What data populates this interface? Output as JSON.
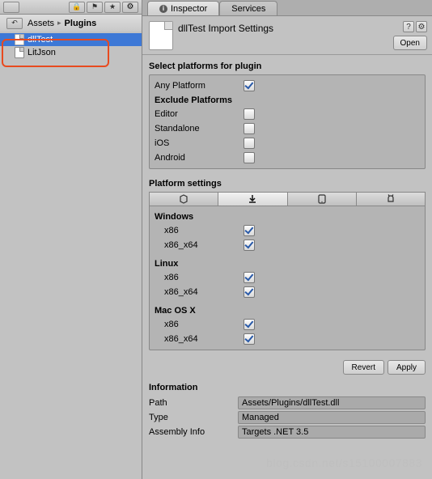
{
  "left": {
    "breadcrumb": {
      "root": "Assets",
      "current": "Plugins"
    },
    "tree": [
      {
        "name": "dllTest",
        "selected": true
      },
      {
        "name": "LitJson",
        "selected": false
      }
    ]
  },
  "tabs": [
    {
      "label": "Inspector",
      "icon": "info",
      "active": true
    },
    {
      "label": "Services",
      "active": false
    }
  ],
  "header": {
    "title": "dllTest Import Settings",
    "open_label": "Open"
  },
  "select_platforms": {
    "title": "Select platforms for plugin",
    "any_label": "Any Platform",
    "any_checked": true,
    "exclude_title": "Exclude Platforms",
    "rows": [
      {
        "label": "Editor",
        "checked": false
      },
      {
        "label": "Standalone",
        "checked": false
      },
      {
        "label": "iOS",
        "checked": false
      },
      {
        "label": "Android",
        "checked": false
      }
    ]
  },
  "platform_settings": {
    "title": "Platform settings",
    "tab_icons": [
      "unity-icon",
      "download-icon",
      "phone-icon",
      "android-icon"
    ],
    "groups": [
      {
        "title": "Windows",
        "rows": [
          {
            "label": "x86",
            "checked": true
          },
          {
            "label": "x86_x64",
            "checked": true
          }
        ]
      },
      {
        "title": "Linux",
        "rows": [
          {
            "label": "x86",
            "checked": true
          },
          {
            "label": "x86_x64",
            "checked": true
          }
        ]
      },
      {
        "title": "Mac OS X",
        "rows": [
          {
            "label": "x86",
            "checked": true
          },
          {
            "label": "x86_x64",
            "checked": true
          }
        ]
      }
    ]
  },
  "buttons": {
    "revert": "Revert",
    "apply": "Apply"
  },
  "information": {
    "title": "Information",
    "rows": [
      {
        "label": "Path",
        "value": "Assets/Plugins/dllTest.dll"
      },
      {
        "label": "Type",
        "value": "Managed"
      },
      {
        "label": "Assembly Info",
        "value": "Targets .NET 3.5"
      }
    ]
  },
  "watermark": "blog.csdn.net/s15100007883"
}
